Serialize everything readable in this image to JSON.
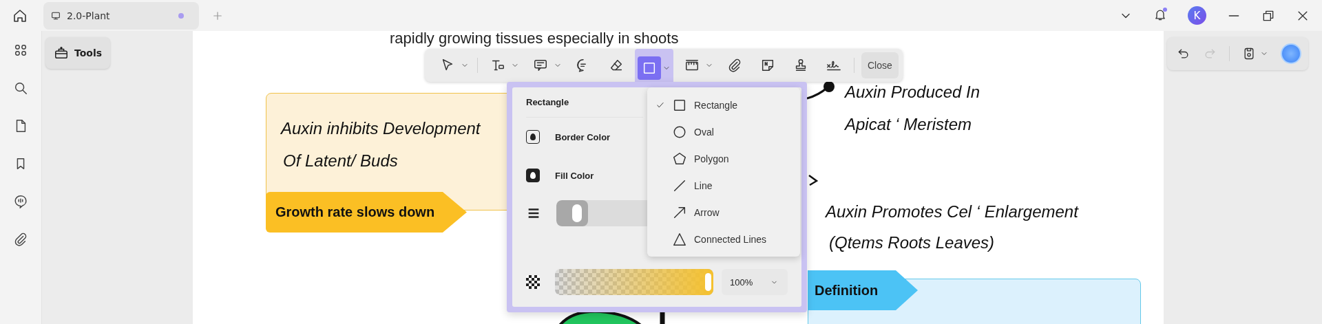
{
  "tab": {
    "title": "2.0-Plant",
    "unsaved": true
  },
  "notifications": {
    "unread": true
  },
  "account": {
    "initial": "K"
  },
  "tools_panel": {
    "label": "Tools"
  },
  "toolbar": {
    "tools": [
      {
        "kind": "select",
        "has_menu": true,
        "selected": false
      },
      {
        "kind": "text",
        "has_menu": true,
        "selected": false
      },
      {
        "kind": "note",
        "has_menu": true,
        "selected": false
      },
      {
        "kind": "comment",
        "has_menu": false,
        "selected": false
      },
      {
        "kind": "eraser",
        "has_menu": false,
        "selected": false
      },
      {
        "kind": "rectangle",
        "has_menu": true,
        "selected": true
      },
      {
        "kind": "measure",
        "has_menu": true,
        "selected": false
      },
      {
        "kind": "attach",
        "has_menu": false,
        "selected": false
      },
      {
        "kind": "sticky",
        "has_menu": false,
        "selected": false
      },
      {
        "kind": "stamp",
        "has_menu": false,
        "selected": false
      },
      {
        "kind": "signature",
        "has_menu": false,
        "selected": false
      }
    ],
    "close": "Close"
  },
  "history": {
    "redo_disabled": true
  },
  "shape_panel": {
    "title": "Rectangle",
    "border_color_label": "Border Color",
    "fill_color_label": "Fill Color",
    "thickness": {
      "level": 0.08
    },
    "opacity": {
      "level": 1,
      "reading": "100%"
    }
  },
  "shape_menu": [
    {
      "kind": "rectangle",
      "label": "Rectangle",
      "selected": true
    },
    {
      "kind": "oval",
      "label": "Oval",
      "selected": false
    },
    {
      "kind": "polygon",
      "label": "Polygon",
      "selected": false
    },
    {
      "kind": "line",
      "label": "Line",
      "selected": false
    },
    {
      "kind": "arrow",
      "label": "Arrow",
      "selected": false
    },
    {
      "kind": "connected",
      "label": "Connected Lines",
      "selected": false
    }
  ],
  "canvas": {
    "top_text": "rapidly growing tissues especially in shoots",
    "yellow_card": {
      "lines": [
        "Auxin inhibits Development",
        "Of Latent/ Buds"
      ],
      "tag": "Growth rate slows down"
    },
    "produced": [
      "Auxin Produced In",
      "Apicat ‘ Meristem"
    ],
    "promotes": [
      "Auxin Promotes Cel ‘ Enlargement",
      "(Qtems Roots Leaves)"
    ],
    "definition_tag": "Definition"
  }
}
